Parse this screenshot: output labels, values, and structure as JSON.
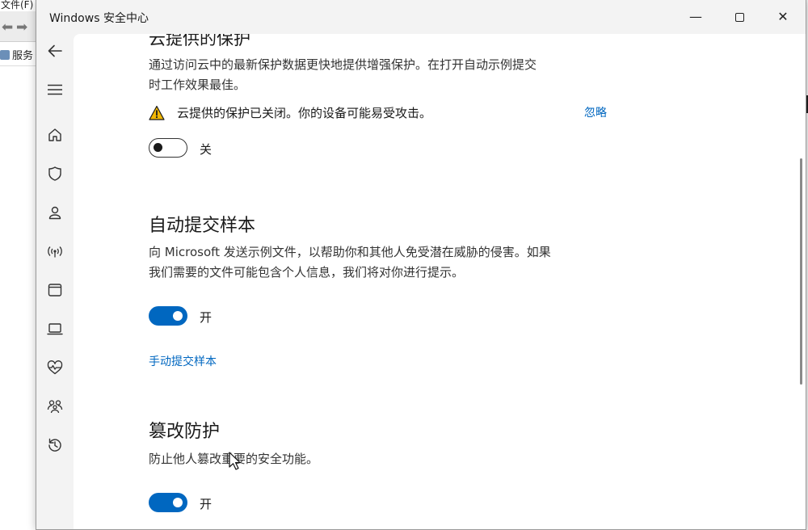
{
  "background_app": {
    "menu_text": "文件(F)",
    "tree_item": "服务"
  },
  "window": {
    "title": "Windows 安全中心",
    "minimize_glyph": "—",
    "close_glyph": "✕"
  },
  "nav": {
    "items": [
      {
        "name": "back-button",
        "icon": "back-arrow-icon"
      },
      {
        "name": "menu-button",
        "icon": "hamburger-icon"
      },
      {
        "name": "nav-home",
        "icon": "home-icon"
      },
      {
        "name": "nav-virus-protection",
        "icon": "shield-icon"
      },
      {
        "name": "nav-account-protection",
        "icon": "person-icon"
      },
      {
        "name": "nav-firewall",
        "icon": "wireless-icon"
      },
      {
        "name": "nav-app-browser-control",
        "icon": "app-window-icon"
      },
      {
        "name": "nav-device-security",
        "icon": "laptop-icon"
      },
      {
        "name": "nav-device-performance",
        "icon": "heart-pulse-icon"
      },
      {
        "name": "nav-family-options",
        "icon": "family-icon"
      },
      {
        "name": "nav-protection-history",
        "icon": "history-icon"
      }
    ]
  },
  "cloud": {
    "title_clipped": "云提供的保护",
    "desc_line1": "通过访问云中的最新保护数据更快地提供增强保护。在打开自动示例提交",
    "desc_line2": "时工作效果最佳。",
    "warning": "云提供的保护已关闭。你的设备可能易受攻击。",
    "ignore_link": "忽略",
    "toggle_state": "off",
    "toggle_label": "关"
  },
  "auto_submit": {
    "title": "自动提交样本",
    "desc_line1": "向 Microsoft 发送示例文件，以帮助你和其他人免受潜在威胁的侵害。如果",
    "desc_line2": "我们需要的文件可能包含个人信息，我们将对你进行提示。",
    "toggle_state": "on",
    "toggle_label": "开",
    "manual_link": "手动提交样本"
  },
  "tamper": {
    "title": "篡改防护",
    "desc": "防止他人篡改重要的安全功能。",
    "toggle_state": "on",
    "toggle_label": "开"
  },
  "colors": {
    "accent": "#0067c0",
    "warning": "#f2b705"
  }
}
